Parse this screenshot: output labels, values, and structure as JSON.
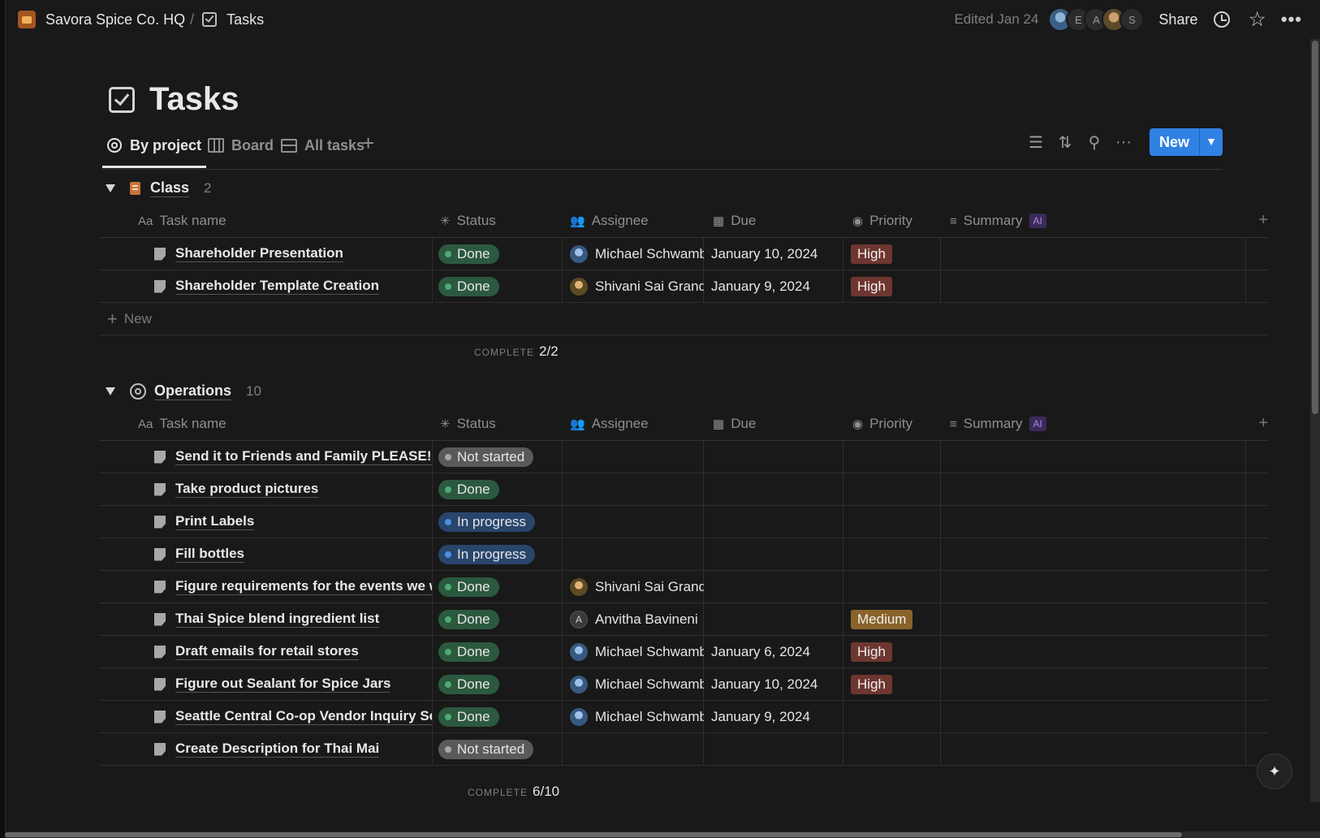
{
  "breadcrumb": {
    "workspace": "Savora Spice Co. HQ",
    "separator": "/",
    "page": "Tasks"
  },
  "topbar": {
    "edited": "Edited Jan 24",
    "avatars": [
      "",
      "E",
      "A",
      "",
      "S"
    ],
    "share": "Share"
  },
  "page": {
    "title": "Tasks"
  },
  "views": {
    "tabs": [
      {
        "label": "By project",
        "active": true
      },
      {
        "label": "Board",
        "active": false
      },
      {
        "label": "All tasks",
        "active": false
      }
    ],
    "add": "+",
    "new_button": "New"
  },
  "columns": {
    "name": "Task name",
    "name_icon": "Aa",
    "status": "Status",
    "assignee": "Assignee",
    "due": "Due",
    "priority": "Priority",
    "summary": "Summary",
    "summary_badge": "AI",
    "add": "+"
  },
  "colors": {
    "done_bg": "#2b593f",
    "done_dot": "#4dab72",
    "not_started_bg": "#5a5a5a",
    "not_started_dot": "#a8a8a8",
    "in_progress_bg": "#28456c",
    "in_progress_dot": "#4b8fe6",
    "high": "#6e3630",
    "medium": "#89632a",
    "accent": "#2f81e4"
  },
  "groups": [
    {
      "name": "Class",
      "count": "2",
      "icon": "book-icon",
      "new_label": "New",
      "calc_label": "COMPLETE",
      "calc_value": "2/2",
      "rows": [
        {
          "name": "Shareholder Presentation",
          "status": "Done",
          "status_key": "done",
          "assignee": "Michael Schwamb",
          "avatar": "michael",
          "due": "January 10, 2024",
          "priority": "High",
          "priority_key": "high"
        },
        {
          "name": "Shareholder Template Creation",
          "status": "Done",
          "status_key": "done",
          "assignee": "Shivani Sai Grandh",
          "avatar": "shivani",
          "due": "January 9, 2024",
          "priority": "High",
          "priority_key": "high"
        }
      ]
    },
    {
      "name": "Operations",
      "count": "10",
      "icon": "target-icon",
      "calc_label": "COMPLETE",
      "calc_value": "6/10",
      "rows": [
        {
          "name": "Send it to Friends and Family PLEASE!!!",
          "status": "Not started",
          "status_key": "not_started",
          "assignee": "",
          "avatar": "",
          "due": "",
          "priority": "",
          "priority_key": ""
        },
        {
          "name": "Take product pictures",
          "status": "Done",
          "status_key": "done",
          "assignee": "",
          "avatar": "",
          "due": "",
          "priority": "",
          "priority_key": ""
        },
        {
          "name": "Print Labels",
          "status": "In progress",
          "status_key": "in_progress",
          "assignee": "",
          "avatar": "",
          "due": "",
          "priority": "",
          "priority_key": ""
        },
        {
          "name": "Fill bottles",
          "status": "In progress",
          "status_key": "in_progress",
          "assignee": "",
          "avatar": "",
          "due": "",
          "priority": "",
          "priority_key": ""
        },
        {
          "name": "Figure requirements for the events we wa",
          "status": "Done",
          "status_key": "done",
          "assignee": "Shivani Sai Grandh",
          "avatar": "shivani",
          "due": "",
          "priority": "",
          "priority_key": ""
        },
        {
          "name": "Thai Spice blend ingredient list",
          "status": "Done",
          "status_key": "done",
          "assignee": "Anvitha Bavineni",
          "avatar": "A",
          "due": "",
          "priority": "Medium",
          "priority_key": "medium"
        },
        {
          "name": "Draft emails for retail stores",
          "status": "Done",
          "status_key": "done",
          "assignee": "Michael Schwamb",
          "avatar": "michael",
          "due": "January 6, 2024",
          "priority": "High",
          "priority_key": "high"
        },
        {
          "name": "Figure out Sealant for Spice Jars",
          "status": "Done",
          "status_key": "done",
          "assignee": "Michael Schwamb",
          "avatar": "michael",
          "due": "January 10, 2024",
          "priority": "High",
          "priority_key": "high"
        },
        {
          "name": "Seattle Central Co-op Vendor Inquiry Ser",
          "status": "Done",
          "status_key": "done",
          "assignee": "Michael Schwamb",
          "avatar": "michael",
          "due": "January 9, 2024",
          "priority": "",
          "priority_key": ""
        },
        {
          "name": "Create Description for Thai Mai",
          "status": "Not started",
          "status_key": "not_started",
          "assignee": "",
          "avatar": "",
          "due": "",
          "priority": "",
          "priority_key": ""
        }
      ]
    }
  ]
}
